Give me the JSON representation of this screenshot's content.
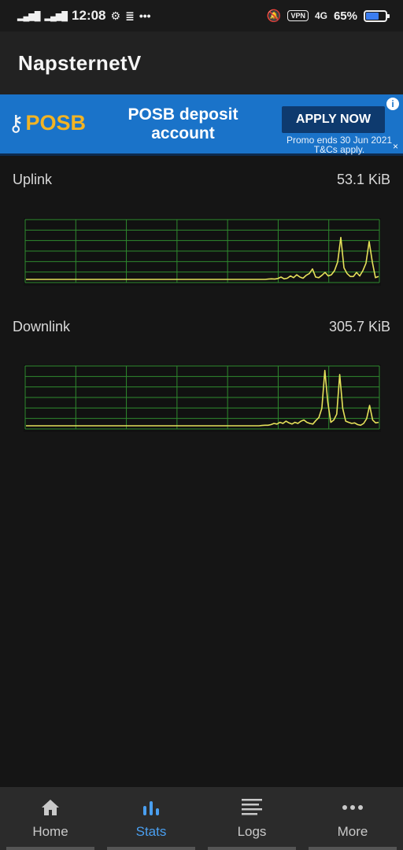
{
  "status_bar": {
    "time": "12:08",
    "signal1": "4G",
    "signal2": "4G",
    "vpn": "VPN",
    "network": "4G",
    "battery": "65%",
    "battery_level": 0.65
  },
  "app": {
    "title": "NapsternetV"
  },
  "ad": {
    "brand": "POSB",
    "headline": "POSB deposit account",
    "cta": "APPLY NOW",
    "promo_line1": "Promo ends 30 Jun 2021",
    "promo_line2": "T&Cs apply.",
    "info": "i",
    "close": "×",
    "colors": {
      "background": "#1a73c9",
      "brand": "#f2b424",
      "button": "#0e3a6e"
    }
  },
  "stats": {
    "uplink": {
      "label": "Uplink",
      "value": "53.1 KiB"
    },
    "downlink": {
      "label": "Downlink",
      "value": "305.7 KiB"
    }
  },
  "chart_data": [
    {
      "type": "line",
      "series": [
        {
          "color": "#e6e15a",
          "values": [
            0,
            0,
            0,
            0,
            0,
            0,
            0,
            0,
            0,
            0,
            0,
            0,
            0,
            0,
            0,
            0,
            0,
            0,
            0,
            0,
            0,
            0,
            0,
            0,
            0,
            0,
            0,
            0,
            0,
            0,
            0,
            0,
            0,
            0,
            0,
            0,
            0,
            0,
            0,
            0,
            0,
            0,
            0,
            0,
            0,
            0,
            0,
            0,
            0,
            0,
            0,
            0,
            0,
            0,
            0,
            0,
            0,
            0,
            0,
            0,
            0,
            0,
            0,
            0,
            0,
            0,
            0,
            0,
            0,
            0,
            0,
            0,
            0,
            0,
            0,
            0,
            0,
            0.5,
            1,
            0.5,
            1.5,
            4,
            1,
            2,
            6,
            3,
            8,
            4,
            2,
            7,
            10,
            18,
            4,
            3,
            7,
            12,
            6,
            8,
            15,
            30,
            72,
            20,
            10,
            5,
            5,
            12,
            6,
            15,
            28,
            65,
            30,
            3,
            5
          ]
        }
      ],
      "grid": true,
      "grid_color": "#2f8a2f"
    },
    {
      "type": "line",
      "series": [
        {
          "color": "#e6e15a",
          "values": [
            0,
            0,
            0,
            0,
            0,
            0,
            0,
            0,
            0,
            0,
            0,
            0,
            0,
            0,
            0,
            0,
            0,
            0,
            0,
            0,
            0,
            0,
            0,
            0,
            0,
            0,
            0,
            0,
            0,
            0,
            0,
            0,
            0,
            0,
            0,
            0,
            0,
            0,
            0,
            0,
            0,
            0,
            0,
            0,
            0,
            0,
            0,
            0,
            0,
            0,
            0,
            0,
            0,
            0,
            0,
            0,
            0,
            0,
            0,
            0,
            0,
            0,
            0,
            0,
            0,
            0,
            0,
            0,
            0,
            0,
            0,
            0,
            0,
            0,
            0,
            0,
            0,
            0,
            0,
            0.5,
            1,
            1,
            2,
            4,
            3,
            6,
            4,
            8,
            5,
            3,
            6,
            4,
            8,
            10,
            6,
            4,
            3,
            9,
            14,
            30,
            95,
            40,
            6,
            10,
            20,
            88,
            30,
            8,
            6,
            4,
            5,
            2,
            1,
            4,
            12,
            35,
            10,
            5,
            6
          ]
        }
      ],
      "grid": true,
      "grid_color": "#2f8a2f"
    }
  ],
  "nav": {
    "items": [
      {
        "label": "Home",
        "icon": "home-icon",
        "active": false
      },
      {
        "label": "Stats",
        "icon": "bar-chart-icon",
        "active": true
      },
      {
        "label": "Logs",
        "icon": "list-icon",
        "active": false
      },
      {
        "label": "More",
        "icon": "more-dots-icon",
        "active": false
      }
    ],
    "active_color": "#4a9ff0"
  }
}
